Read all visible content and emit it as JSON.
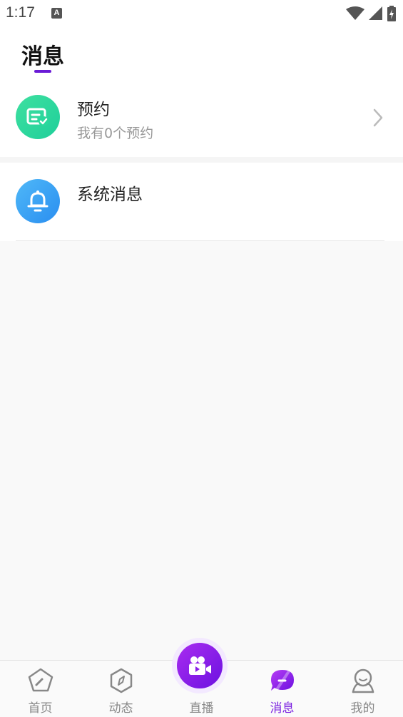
{
  "status_bar": {
    "time": "1:17",
    "notification_icon_letter": "A",
    "icons": [
      "wifi-icon",
      "signal-icon",
      "battery-icon"
    ]
  },
  "header": {
    "title": "消息",
    "accent_color": "#6a1bd6"
  },
  "messages": [
    {
      "title": "预约",
      "subtitle": "我有0个预约",
      "icon": "appointment-check-icon",
      "icon_color": "#2ad89c"
    },
    {
      "title": "系统消息",
      "icon": "bell-icon",
      "icon_color": "#3a9ef4"
    }
  ],
  "bottom_nav": {
    "items": [
      {
        "label": "首页",
        "icon": "home-pentagon-icon"
      },
      {
        "label": "动态",
        "icon": "compass-icon"
      },
      {
        "label": "直播",
        "icon": "video-camera-icon"
      },
      {
        "label": "消息",
        "icon": "message-bubble-icon",
        "active": true
      },
      {
        "label": "我的",
        "icon": "user-profile-icon"
      }
    ],
    "active_color": "#7a1fe0"
  }
}
